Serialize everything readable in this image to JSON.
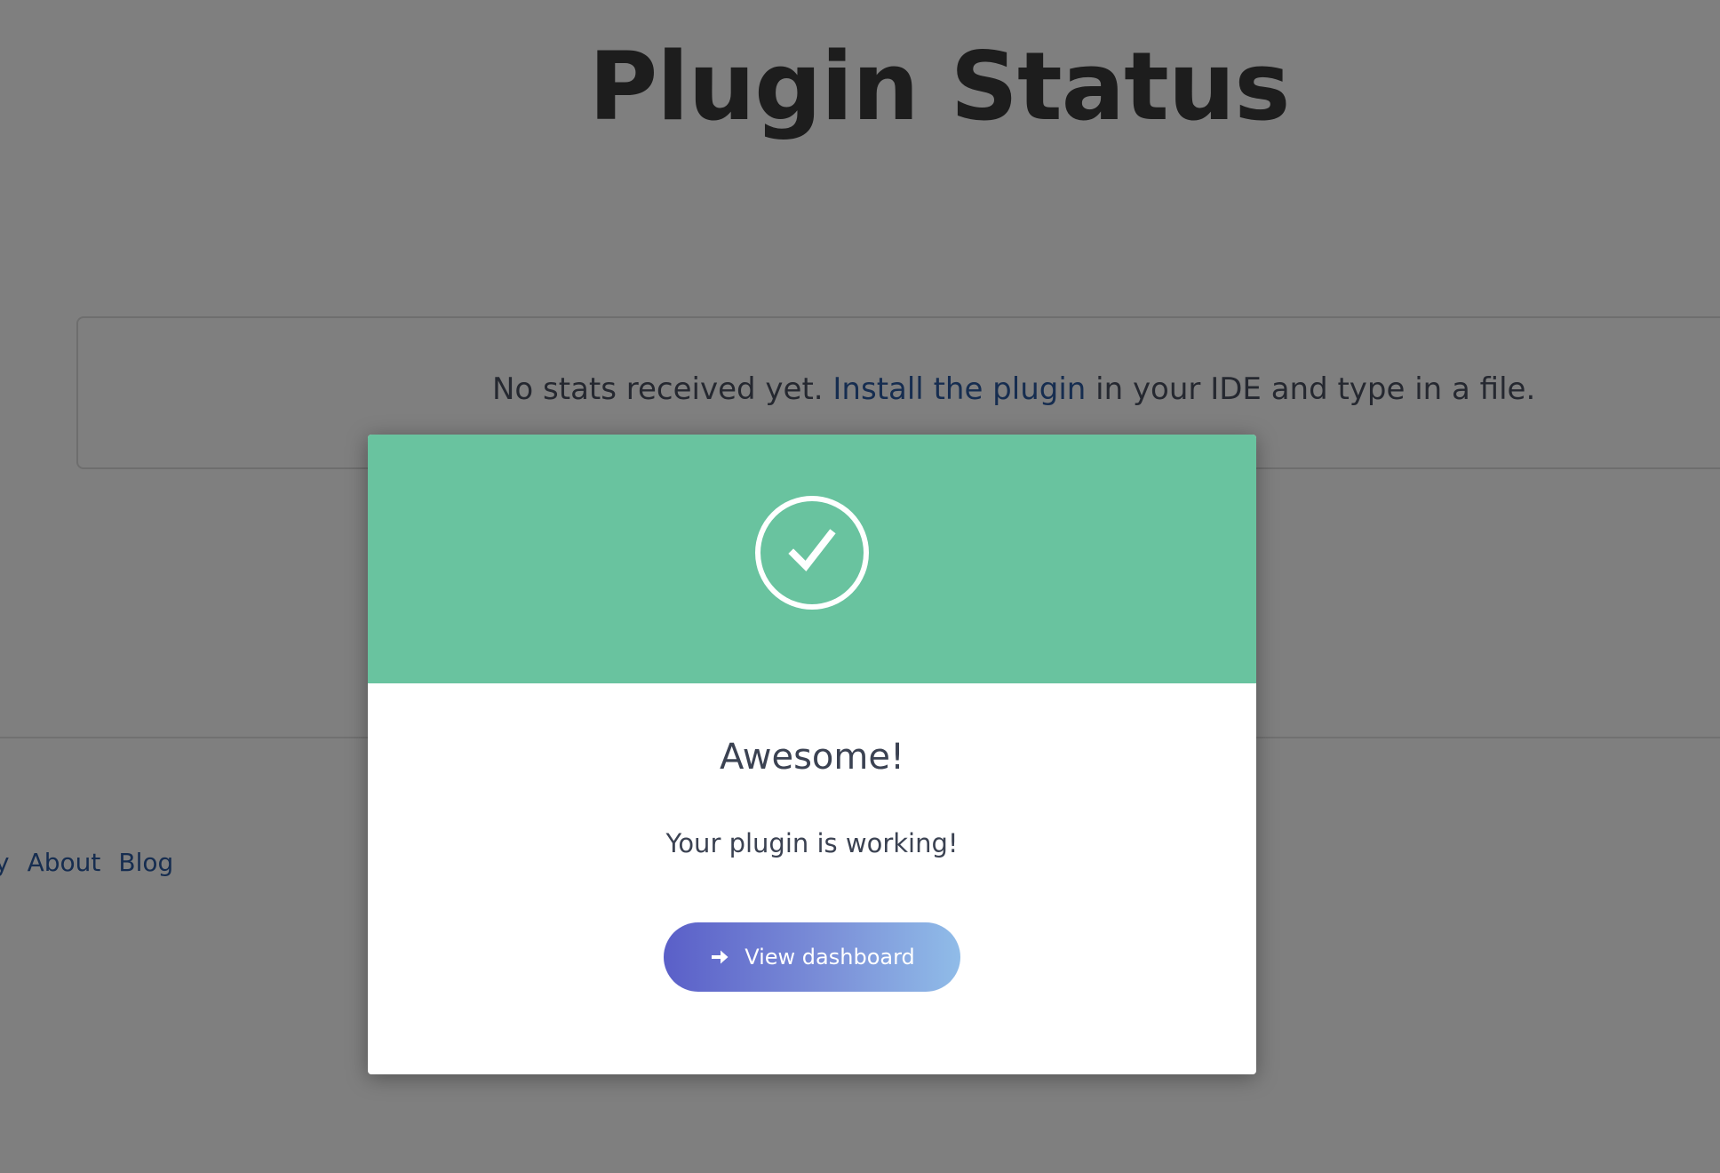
{
  "page": {
    "title": "Plugin Status",
    "stats_message": {
      "before_link": "No stats received yet. ",
      "link_text": "Install the plugin",
      "after_link": " in your IDE and type in a file."
    },
    "footer_links": [
      {
        "label": "y"
      },
      {
        "label": "About"
      },
      {
        "label": "Blog"
      }
    ]
  },
  "modal": {
    "icon": "checkmark-circle-icon",
    "title": "Awesome!",
    "message": "Your plugin is working!",
    "button": {
      "label": "View dashboard",
      "icon": "arrow-right-icon"
    }
  },
  "colors": {
    "header_green": "#69c39f",
    "link_blue": "#2c5aa0",
    "button_gradient_start": "#5a5fc8",
    "button_gradient_end": "#90bce8",
    "overlay": "rgba(0,0,0,0.5)"
  }
}
